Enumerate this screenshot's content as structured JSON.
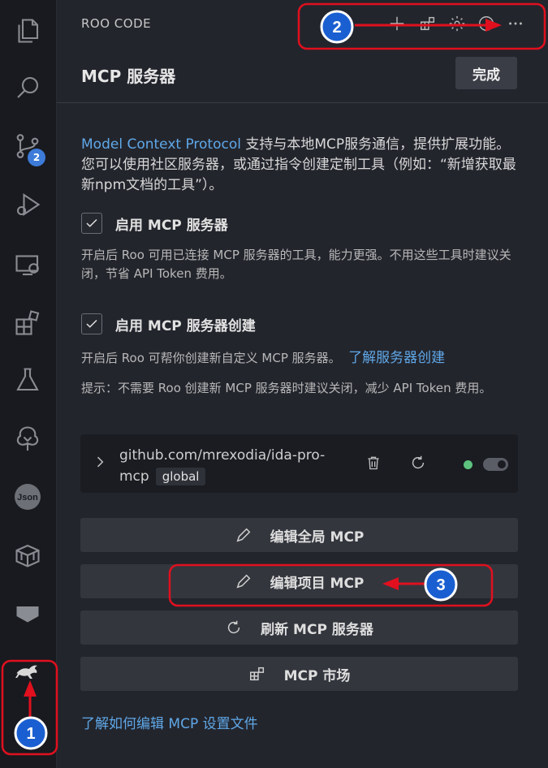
{
  "header": {
    "app_title": "ROO CODE",
    "page_title": "MCP 服务器",
    "done_label": "完成",
    "icons": [
      "plus-icon",
      "extensions-icon",
      "gear-icon",
      "history-icon",
      "more-icon"
    ]
  },
  "activity_bar": {
    "items": [
      "explorer-icon",
      "search-icon",
      "source-control-icon",
      "run-debug-icon",
      "remote-explorer-icon",
      "extensions-icon",
      "testing-icon",
      "tree-icon",
      "json-icon",
      "package-icon",
      "terminal-icon",
      "roo-code-icon"
    ],
    "source_control_badge": "2"
  },
  "intro": {
    "link": "Model Context Protocol",
    "text": " 支持与本地MCP服务通信，提供扩展功能。您可以使用社区服务器，或通过指令创建定制工具（例如：“新增获取最新npm文档的工具”）。"
  },
  "enable_mcp": {
    "label": "启用 MCP 服务器",
    "checked": true,
    "desc": "开启后 Roo 可用已连接 MCP 服务器的工具，能力更强。不用这些工具时建议关闭，节省 API Token 费用。"
  },
  "enable_create": {
    "label": "启用 MCP 服务器创建",
    "checked": true,
    "desc": "开启后 Roo 可帮你创建新自定义 MCP 服务器。",
    "learn_link": "了解服务器创建",
    "tip": "提示：不需要 Roo 创建新 MCP 服务器时建议关闭，减少 API Token 费用。"
  },
  "server": {
    "name": "github.com/mrexodia/ida-pro-mcp",
    "scope": "global",
    "status_color": "#5dc27d"
  },
  "actions": {
    "edit_global": "编辑全局 MCP",
    "edit_project": "编辑项目 MCP",
    "refresh": "刷新 MCP 服务器",
    "market": "MCP 市场"
  },
  "footer_link": "了解如何编辑 MCP 设置文件",
  "annotations": {
    "step1": "1",
    "step2": "2",
    "step3": "3",
    "color": "#e0101e"
  }
}
